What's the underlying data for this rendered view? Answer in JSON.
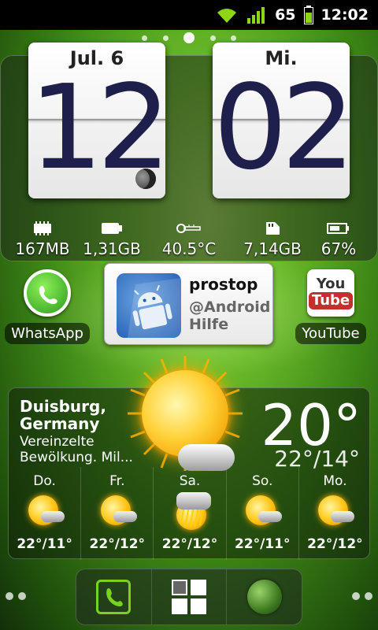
{
  "status_bar": {
    "battery_level": "65",
    "time": "12:02",
    "wifi_icon": "wifi-icon",
    "signal_icon": "signal-bars-icon"
  },
  "clock": {
    "date": "Jul. 6",
    "weekday": "Mi.",
    "hour": "12",
    "minute": "02"
  },
  "stats": [
    {
      "icon": "memory-chip-icon",
      "value": "167MB"
    },
    {
      "icon": "sd-card-icon",
      "value": "1,31GB"
    },
    {
      "icon": "thermometer-icon",
      "value": "40.5°C"
    },
    {
      "icon": "storage-icon",
      "value": "7,14GB"
    },
    {
      "icon": "battery-icon",
      "value": "67%"
    }
  ],
  "apps": {
    "whatsapp": "WhatsApp",
    "youtube": "YouTube",
    "youtube_icon_you": "You",
    "youtube_icon_tube": "Tube"
  },
  "prostop": {
    "name": "prostop",
    "handle": "@Android Hilfe"
  },
  "weather": {
    "city": "Duisburg,\nGermany",
    "description": "Vereinzelte\nBewölkung. Mil...",
    "current_temp": "20°",
    "hi_lo": "22°/14°",
    "forecast": [
      {
        "day": "Do.",
        "temp": "22°/11°",
        "icon": "sun-cloud-icon"
      },
      {
        "day": "Fr.",
        "temp": "22°/12°",
        "icon": "sun-cloud-icon"
      },
      {
        "day": "Sa.",
        "temp": "22°/12°",
        "icon": "rain-cloud-icon"
      },
      {
        "day": "So.",
        "temp": "22°/11°",
        "icon": "sun-cloud-icon"
      },
      {
        "day": "Mo.",
        "temp": "22°/12°",
        "icon": "sun-cloud-icon"
      }
    ]
  },
  "colors": {
    "accent_green": "#7ad21e",
    "clock_digit": "#1e1f4a"
  }
}
